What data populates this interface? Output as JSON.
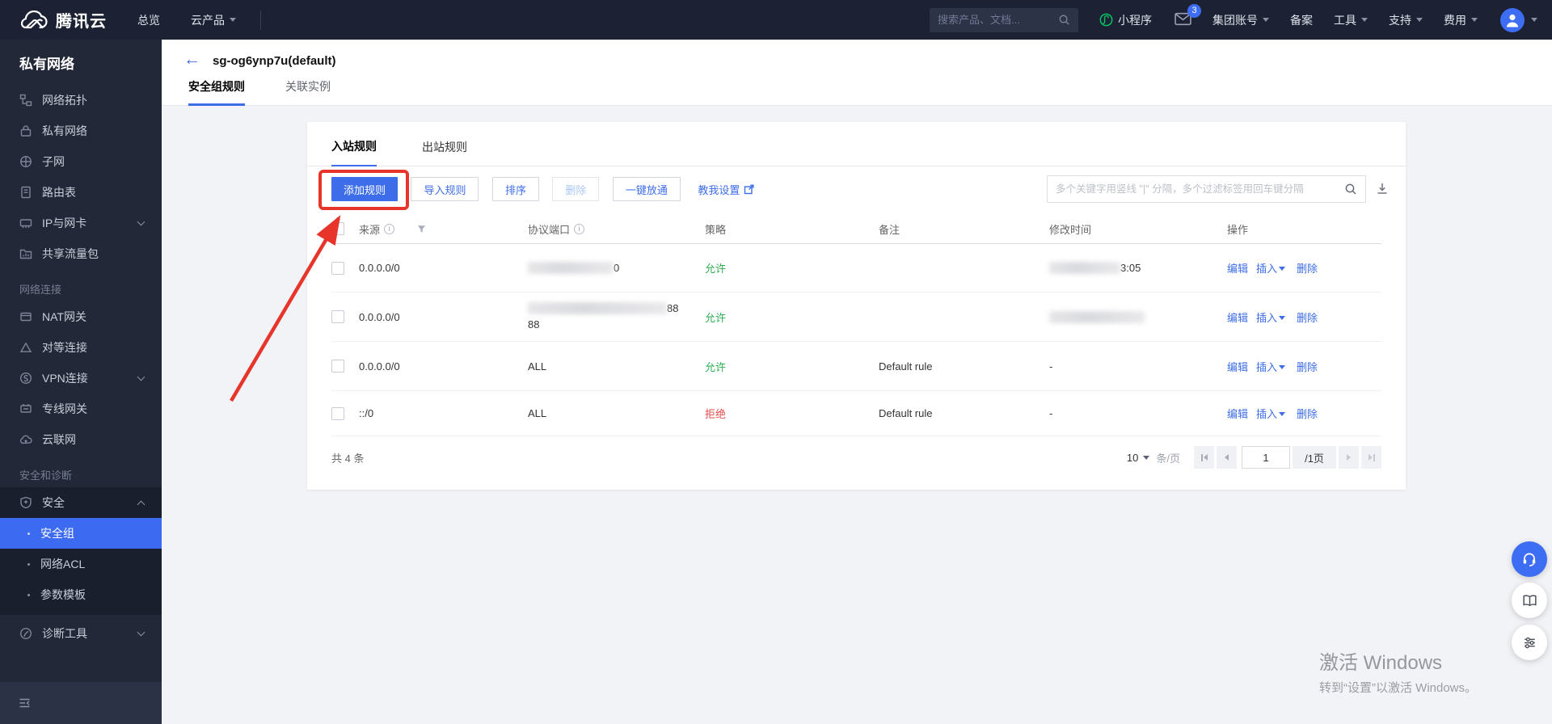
{
  "topbar": {
    "logo": "腾讯云",
    "overview": "总览",
    "products": "云产品",
    "search_placeholder": "搜索产品、文档...",
    "miniprogram": "小程序",
    "mail_badge": "3",
    "group_account": "集团账号",
    "beian": "备案",
    "tools": "工具",
    "support": "支持",
    "billing": "费用"
  },
  "sidebar": {
    "title": "私有网络",
    "items": [
      "网络拓扑",
      "私有网络",
      "子网",
      "路由表",
      "IP与网卡",
      "共享流量包"
    ],
    "section_network": "网络连接",
    "items2": [
      "NAT网关",
      "对等连接",
      "VPN连接",
      "专线网关",
      "云联网"
    ],
    "section_security": "安全和诊断",
    "security_group": "安全",
    "security_items": [
      "安全组",
      "网络ACL",
      "参数模板"
    ],
    "diagnose": "诊断工具"
  },
  "page_header": {
    "back": "←",
    "title": "sg-og6ynp7u(default)",
    "tab_rules": "安全组规则",
    "tab_instances": "关联实例"
  },
  "panel": {
    "tab_inbound": "入站规则",
    "tab_outbound": "出站规则",
    "btn_add": "添加规则",
    "btn_import": "导入规则",
    "btn_sort": "排序",
    "btn_delete": "删除",
    "btn_open_all": "一键放通",
    "link_teach": "教我设置",
    "search_placeholder": "多个关键字用竖线 \"|\" 分隔，多个过滤标签用回车键分隔"
  },
  "table": {
    "col_source": "来源",
    "col_protocol": "协议端口",
    "col_policy": "策略",
    "col_notes": "备注",
    "col_modified": "修改时间",
    "col_actions": "操作",
    "action_edit": "编辑",
    "action_insert": "插入",
    "action_delete": "删除",
    "rows": [
      {
        "source": "0.0.0.0/0",
        "protocol_visible": "0",
        "policy": "允许",
        "notes": "",
        "modified_visible": "3:05"
      },
      {
        "source": "0.0.0.0/0",
        "protocol_visible": "88",
        "protocol_line2": "88",
        "policy": "允许",
        "notes": "",
        "modified_visible": ""
      },
      {
        "source": "0.0.0.0/0",
        "protocol_visible": "ALL",
        "policy": "允许",
        "notes": "Default rule",
        "modified_visible": "-"
      },
      {
        "source": "::/0",
        "protocol_visible": "ALL",
        "policy": "拒绝",
        "notes": "Default rule",
        "modified_visible": "-"
      }
    ]
  },
  "pagination": {
    "total": "共 4 条",
    "page_size": "10",
    "unit": "条/页",
    "page": "1",
    "pages_label": "/1页"
  },
  "watermark": {
    "line1": "激活 Windows",
    "line2": "转到“设置”以激活 Windows。"
  },
  "colors": {
    "primary_blue": "#3d6de8",
    "sidebar_selected_blue": "#3c6af0",
    "allow_green": "#2eaf53",
    "deny_red": "#e34d4d",
    "annotation_red": "#e8352c",
    "miniprogram_green": "#07c160",
    "topbar_bg": "#1c2233",
    "sidebar_bg": "#222837"
  }
}
